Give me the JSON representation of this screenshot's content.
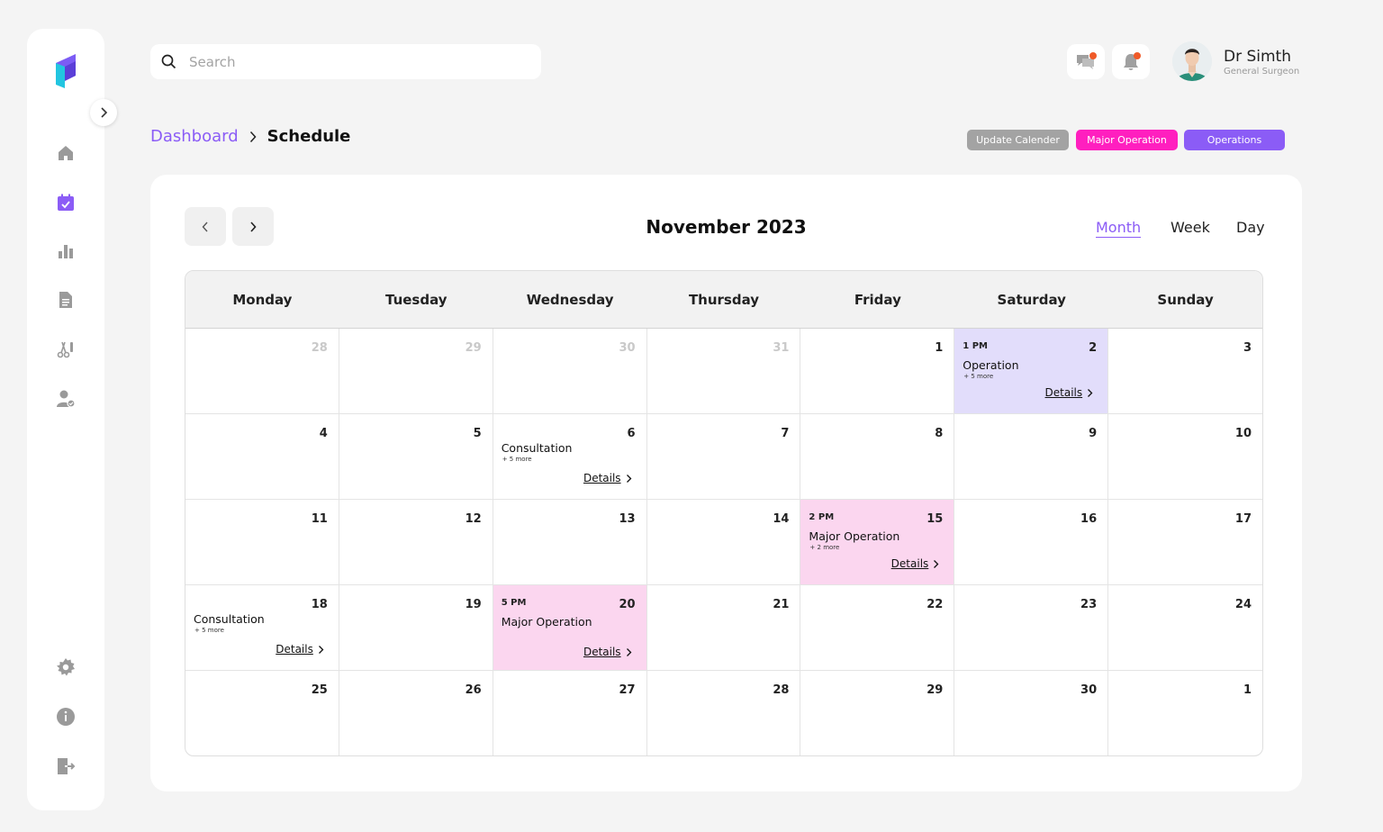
{
  "colors": {
    "accent": "#8b5cf6",
    "gray_badge": "#a3a3a3",
    "major_badge": "#ff1fbf",
    "operation_cell": "#e2ddfb",
    "major_cell": "#fbd6ef"
  },
  "sidebar": {
    "logo": "brand-logo",
    "items": [
      {
        "icon": "home-icon"
      },
      {
        "icon": "calendar-check-icon",
        "active": true
      },
      {
        "icon": "bar-chart-icon"
      },
      {
        "icon": "document-icon"
      },
      {
        "icon": "scissors-icon"
      },
      {
        "icon": "user-check-icon"
      },
      {
        "icon": "gear-icon"
      },
      {
        "icon": "info-icon"
      },
      {
        "icon": "logout-icon"
      }
    ]
  },
  "header": {
    "search_placeholder": "Search",
    "user": {
      "name": "Dr Simth",
      "role": "General Surgeon"
    }
  },
  "breadcrumb": {
    "parent": "Dashboard",
    "current": "Schedule"
  },
  "legend": {
    "update": "Update Calender",
    "major": "Major Operation",
    "operations": "Operations"
  },
  "calendar": {
    "title": "November 2023",
    "views": [
      "Month",
      "Week",
      "Day"
    ],
    "active_view": "Month",
    "weekdays": [
      "Monday",
      "Tuesday",
      "Wednesday",
      "Thursday",
      "Friday",
      "Saturday",
      "Sunday"
    ],
    "weeks": [
      [
        {
          "day": "28",
          "muted": true
        },
        {
          "day": "29",
          "muted": true
        },
        {
          "day": "30",
          "muted": true
        },
        {
          "day": "31",
          "muted": true
        },
        {
          "day": "1"
        },
        {
          "day": "2",
          "type": "op",
          "time": "1 PM",
          "title": "Operation",
          "more": "+ 5 more",
          "details": "Details"
        },
        {
          "day": "3"
        }
      ],
      [
        {
          "day": "4"
        },
        {
          "day": "5"
        },
        {
          "day": "6",
          "title": "Consultation",
          "more": "+ 5 more",
          "details": "Details"
        },
        {
          "day": "7"
        },
        {
          "day": "8"
        },
        {
          "day": "9"
        },
        {
          "day": "10"
        }
      ],
      [
        {
          "day": "11"
        },
        {
          "day": "12"
        },
        {
          "day": "13"
        },
        {
          "day": "14"
        },
        {
          "day": "15",
          "type": "major",
          "time": "2 PM",
          "title": "Major Operation",
          "more": "+ 2 more",
          "details": "Details"
        },
        {
          "day": "16"
        },
        {
          "day": "17"
        }
      ],
      [
        {
          "day": "18",
          "title": "Consultation",
          "more": "+ 5 more",
          "details": "Details"
        },
        {
          "day": "19"
        },
        {
          "day": "20",
          "type": "major",
          "time": "5 PM",
          "title": "Major Operation",
          "details": "Details"
        },
        {
          "day": "21"
        },
        {
          "day": "22"
        },
        {
          "day": "23"
        },
        {
          "day": "24"
        }
      ],
      [
        {
          "day": "25"
        },
        {
          "day": "26"
        },
        {
          "day": "27"
        },
        {
          "day": "28"
        },
        {
          "day": "29"
        },
        {
          "day": "30"
        },
        {
          "day": "1"
        }
      ]
    ]
  }
}
